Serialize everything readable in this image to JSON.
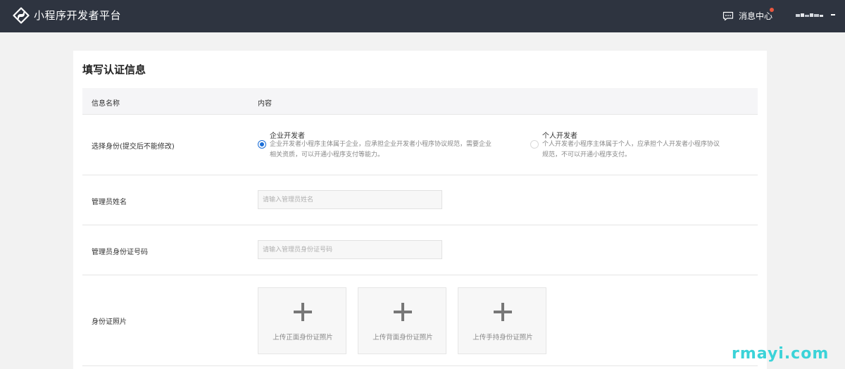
{
  "header": {
    "app_title": "小程序开发者平台",
    "message_center": "消息中心",
    "logo_icon": "mini-program-logo-icon",
    "message_icon": "chat-bubble-icon"
  },
  "form": {
    "title": "填写认证信息",
    "columns": {
      "name": "信息名称",
      "content": "内容"
    },
    "identity": {
      "label": "选择身份(提交后不能修改)",
      "options": [
        {
          "title": "企业开发者",
          "desc_line1": "企业开发者小程序主体属于企业，应承担企业开发者小程序协议规范，需要企业",
          "desc_line2": "相关资质，可以开通小程序支付等能力。",
          "selected": true
        },
        {
          "title": "个人开发者",
          "desc_line1": "个人开发者小程序主体属于个人，应承担个人开发者小程序协议",
          "desc_line2": "规范，不可以开通小程序支付。",
          "selected": false
        }
      ]
    },
    "admin_name": {
      "label": "管理员姓名",
      "placeholder": "请输入管理员姓名",
      "value": ""
    },
    "admin_id": {
      "label": "管理员身份证号码",
      "placeholder": "请输入管理员身份证号码",
      "value": ""
    },
    "id_photos": {
      "label": "身份证照片",
      "uploads": [
        "上传正面身份证照片",
        "上传背面身份证照片",
        "上传手持身份证照片"
      ]
    }
  },
  "watermark": "rmayi.com",
  "colors": {
    "topbar": "#2e3440",
    "accent": "#1a6ed8",
    "notify_dot": "#e9573f",
    "watermark": "#3bd3d8"
  }
}
